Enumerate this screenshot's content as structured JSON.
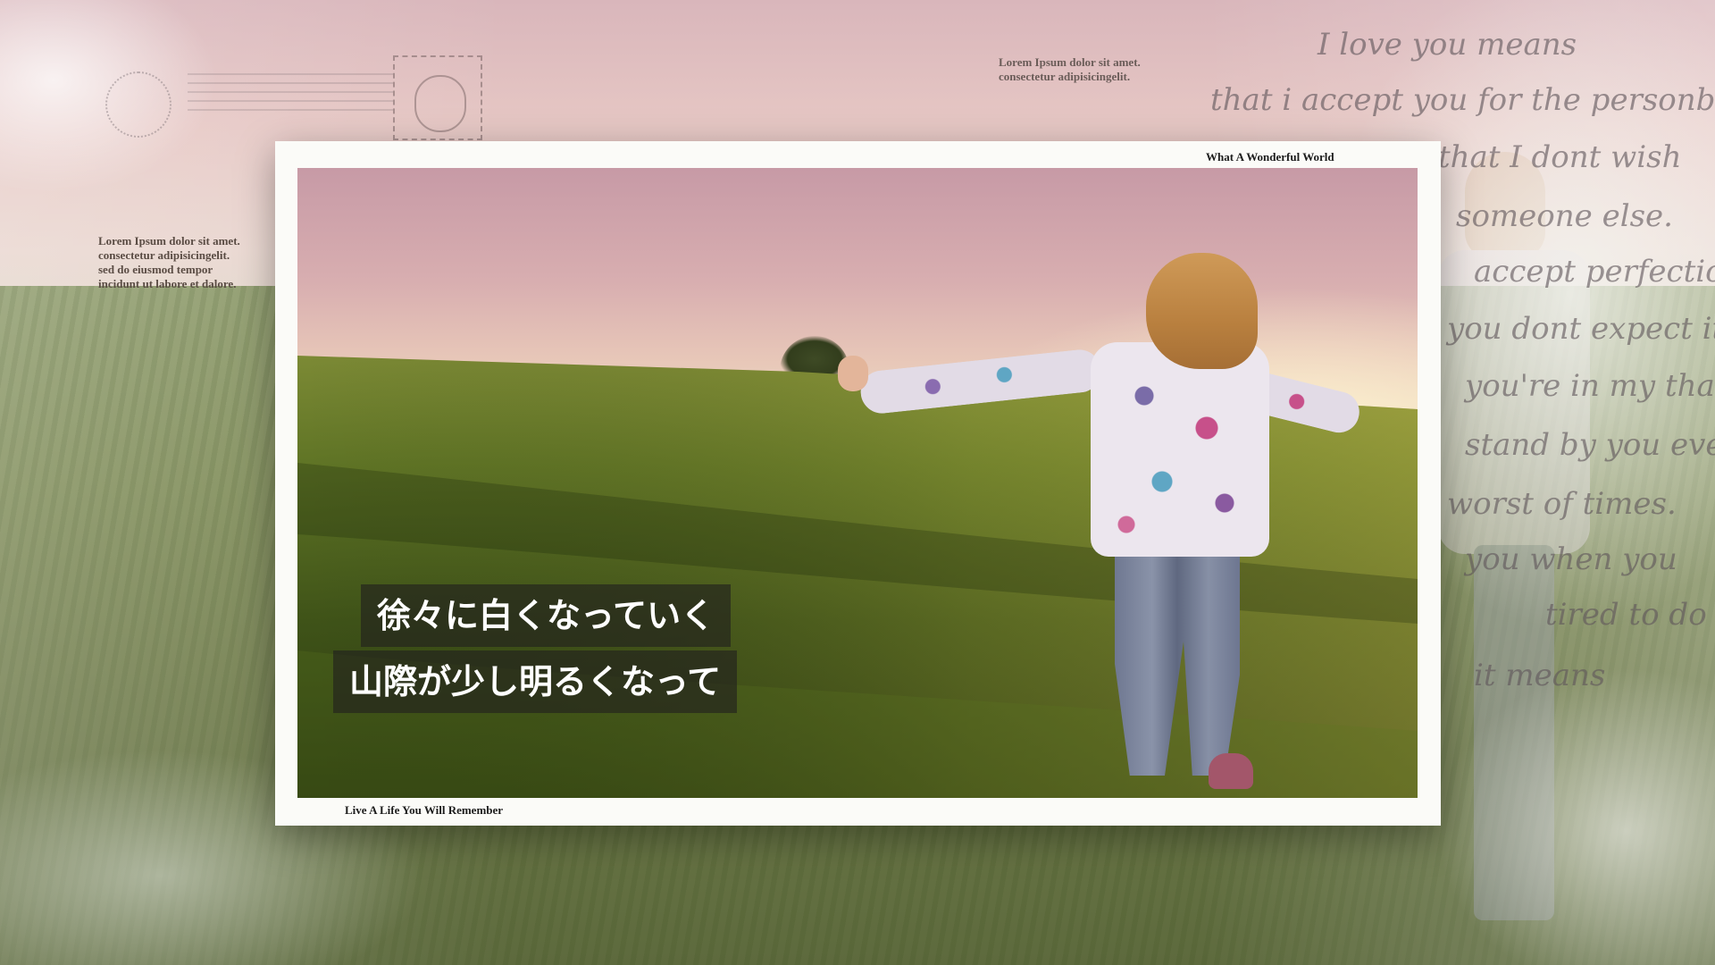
{
  "frame": {
    "top_title": "What A Wonderful World",
    "bottom_title": "Live A Life You Will Remember"
  },
  "subtitles": {
    "line1": "徐々に白くなっていく",
    "line2": "山際が少し明るくなって"
  },
  "lorem": {
    "top": "Lorem Ipsum dolor sit amet.\nconsectetur adipisicingelit.",
    "left": "Lorem Ipsum dolor sit amet.\nconsectetur adipisicingelit.\nsed do eiusmod tempor\nincidunt ut labore et dalore."
  },
  "handwriting_right": [
    "I love you means",
    "that i accept you for the personb",
    "that I dont wish",
    "someone else.",
    "accept perfection",
    "you dont expect it",
    "you're in my that",
    "stand by you even",
    "worst of times.",
    "you when you",
    "tired to do",
    "it means"
  ],
  "colors": {
    "frame": "#fbfbf8",
    "subtitle_bg": "#23231e",
    "subtitle_text": "#ffffff"
  }
}
